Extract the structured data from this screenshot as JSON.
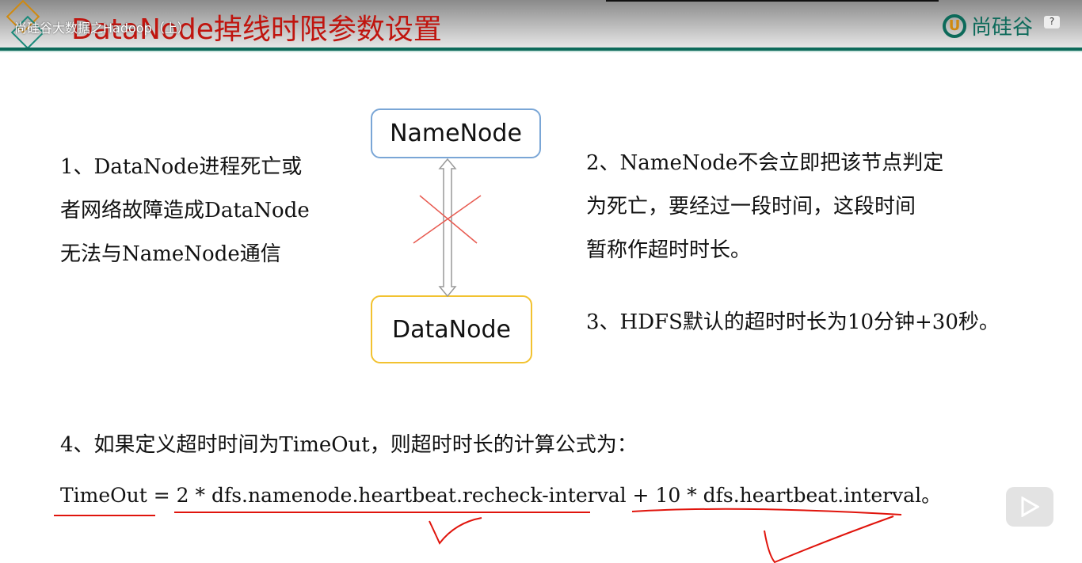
{
  "overlay_title": "尚硅谷大数据之Hadoop（上）",
  "slide_title": "DataNode掉线时限参数设置",
  "logo_text": "尚硅谷",
  "help_label": "?",
  "diagram": {
    "namenode": "NameNode",
    "datanode": "DataNode"
  },
  "left_text": [
    "1、DataNode进程死亡或",
    "者网络故障造成DataNode",
    "无法与NameNode通信"
  ],
  "right_text": [
    "2、NameNode不会立即把该节点判定",
    "为死亡，要经过一段时间，这段时间",
    "暂称作超时时长。"
  ],
  "point3": "3、HDFS默认的超时时长为10分钟+30秒。",
  "point4": "4、如果定义超时时间为TimeOut，则超时时长的计算公式为：",
  "formula": "TimeOut  = 2 * dfs.namenode.heartbeat.recheck-interval + 10 * dfs.heartbeat.interval。",
  "colors": {
    "accent": "#0d6a5a",
    "title": "#c0150f",
    "annotation": "#e0140c"
  }
}
